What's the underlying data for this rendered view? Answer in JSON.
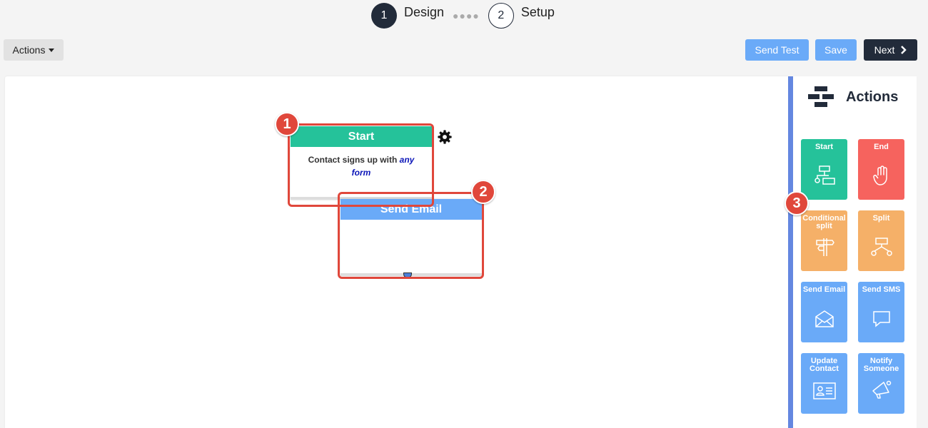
{
  "stepper": {
    "step1_number": "1",
    "step1_label": "Design",
    "step2_number": "2",
    "step2_label": "Setup"
  },
  "toolbar": {
    "actions_label": "Actions",
    "send_test_label": "Send Test",
    "save_label": "Save",
    "next_label": "Next"
  },
  "canvas": {
    "start_node": {
      "title": "Start",
      "body_prefix": "Contact signs up with",
      "body_emphasis": "any form"
    },
    "email_node": {
      "title": "Send Email"
    }
  },
  "annotations": [
    "1",
    "2",
    "3"
  ],
  "sidebar": {
    "title": "Actions",
    "tiles": [
      {
        "label": "Start",
        "icon": "flowchart-icon"
      },
      {
        "label": "End",
        "icon": "hand-stop-icon"
      },
      {
        "label": "Conditional split",
        "icon": "signpost-icon"
      },
      {
        "label": "Split",
        "icon": "split-icon"
      },
      {
        "label": "Send Email",
        "icon": "envelope-open-icon"
      },
      {
        "label": "Send SMS",
        "icon": "chat-bubble-icon"
      },
      {
        "label": "Update Contact",
        "icon": "contact-card-icon"
      },
      {
        "label": "Notify Someone",
        "icon": "megaphone-icon"
      }
    ]
  },
  "colors": {
    "dark": "#222b3a",
    "green": "#25c29a",
    "red": "#f6635e",
    "orange": "#f5b068",
    "blue": "#6aaaf8",
    "highlight": "#e0473b"
  }
}
